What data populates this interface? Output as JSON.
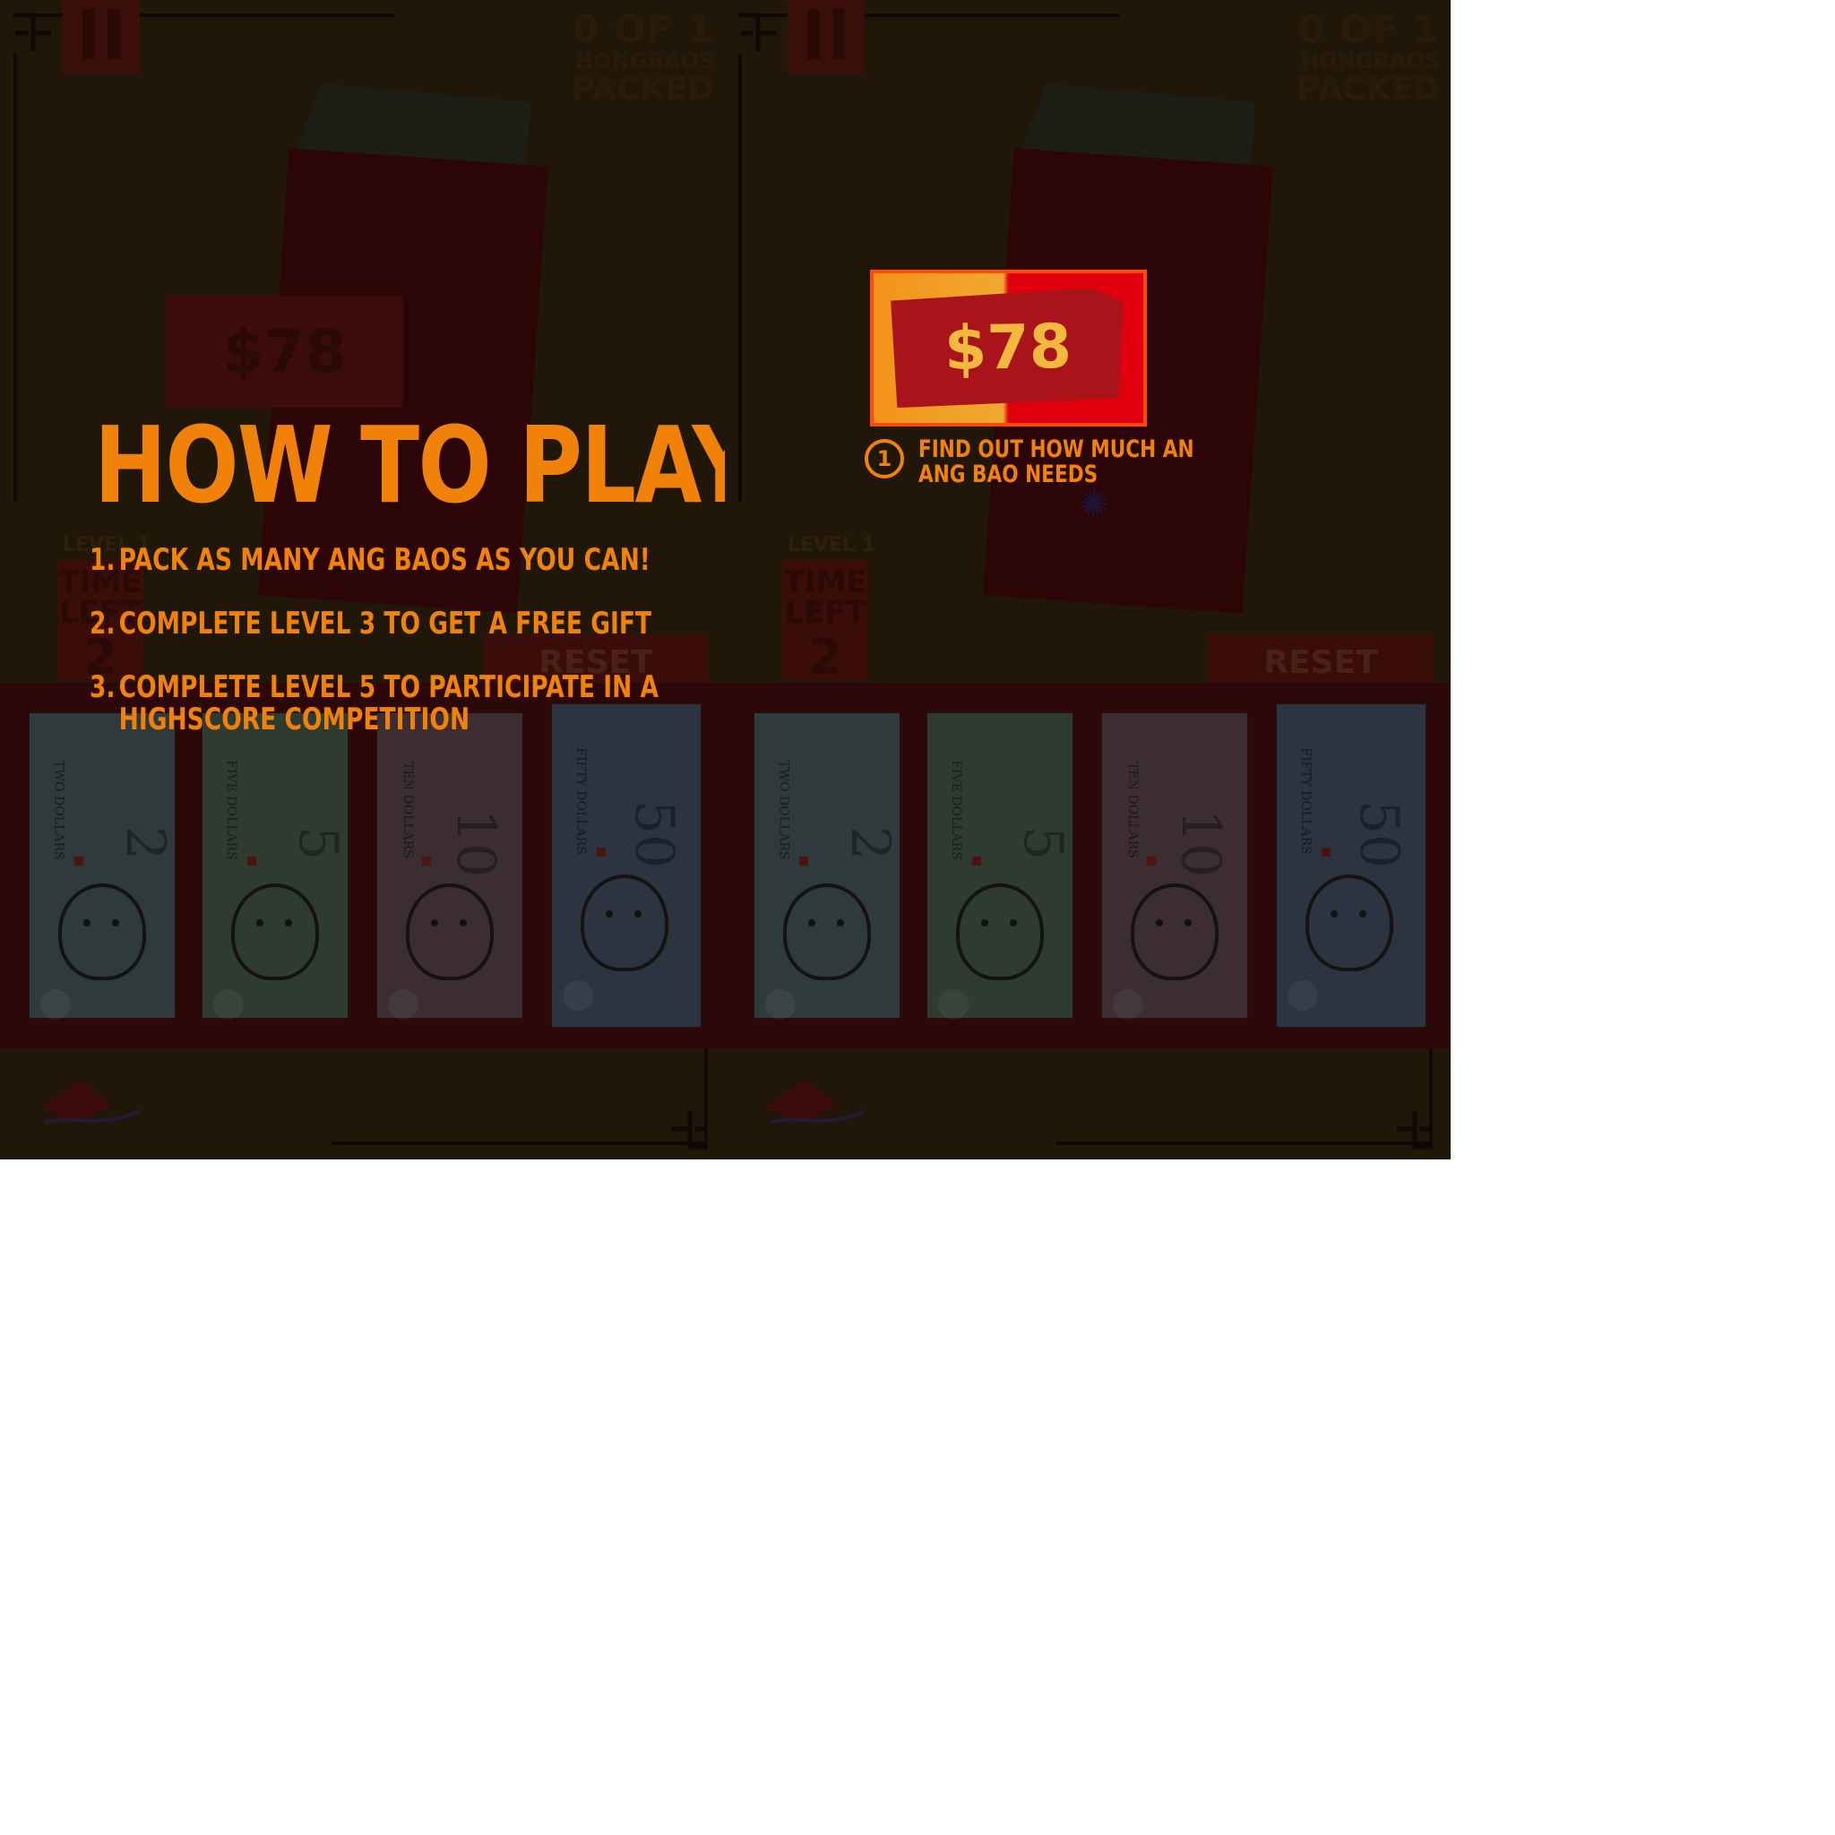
{
  "colors": {
    "accent": "#f0820a",
    "tag_red": "#a8141a",
    "tag_text": "#f3b93e",
    "frame_outline": "#ff4a0a"
  },
  "hud": {
    "counter_line1": "0 OF 1",
    "counter_line2": "HONGBAOS",
    "counter_line3": "PACKED",
    "level_label": "LEVEL 1",
    "time_left_line1": "TIME",
    "time_left_line2": "LEFT",
    "time_left_value": "2",
    "reset_label": "RESET",
    "pause_icon": "pause-icon"
  },
  "envelope": {
    "amount": "$78"
  },
  "bills": [
    {
      "value": "2",
      "word": "TWO DOLLARS",
      "tint": "#2f3a3c"
    },
    {
      "value": "5",
      "word": "FIVE DOLLARS",
      "tint": "#2e3b30"
    },
    {
      "value": "10",
      "word": "TEN DOLLARS",
      "tint": "#3c2e30"
    },
    {
      "value": "50",
      "word": "FIFTY DOLLARS",
      "tint": "#2b3440"
    }
  ],
  "how_to_play": {
    "title": "HOW TO PLAY",
    "steps": [
      {
        "n": "1.",
        "text": "PACK AS MANY ANG BAOS AS YOU CAN!"
      },
      {
        "n": "2.",
        "text": "COMPLETE LEVEL 3 TO GET A FREE GIFT"
      },
      {
        "n": "3.",
        "text": "COMPLETE LEVEL 5 TO PARTICIPATE IN A",
        "text2": "HIGHSCORE COMPETITION"
      }
    ]
  },
  "tutorial_step": {
    "number": "1",
    "line1": "FIND OUT HOW MUCH AN",
    "line2": "ANG BAO NEEDS"
  }
}
